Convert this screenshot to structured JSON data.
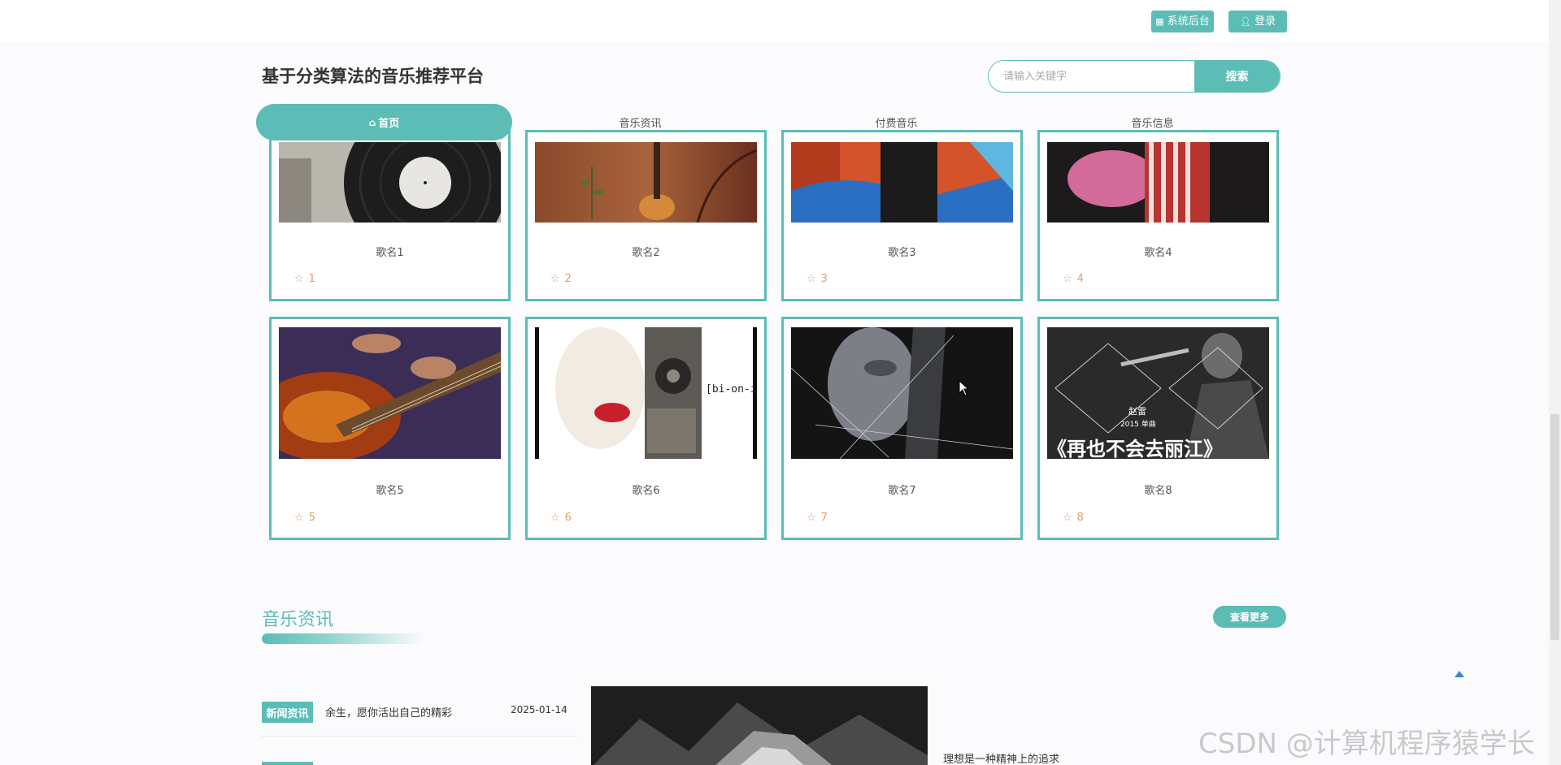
{
  "topbar": {
    "admin_label": "系统后台",
    "login_label": "登录"
  },
  "site_title": "基于分类算法的音乐推荐平台",
  "search": {
    "placeholder": "请输入关键字",
    "button_label": "搜索"
  },
  "nav": {
    "items": [
      "首页",
      "音乐资讯",
      "付费音乐",
      "音乐信息"
    ],
    "active_index": 0
  },
  "songs": [
    {
      "name": "歌名1",
      "rating": "1"
    },
    {
      "name": "歌名2",
      "rating": "2"
    },
    {
      "name": "歌名3",
      "rating": "3"
    },
    {
      "name": "歌名4",
      "rating": "4"
    },
    {
      "name": "歌名5",
      "rating": "5"
    },
    {
      "name": "歌名6",
      "rating": "6"
    },
    {
      "name": "歌名7",
      "rating": "7"
    },
    {
      "name": "歌名8",
      "rating": "8"
    }
  ],
  "image_texts": {
    "song6_label": "[bi-on-ic]",
    "song8_line1": "赵雷",
    "song8_line2": "2015 单曲",
    "song8_title": "《再也不会去丽江》"
  },
  "news_section": {
    "title": "音乐资讯",
    "more_label": "查看更多",
    "items": [
      {
        "tag": "新闻资讯",
        "title": "余生，愿你活出自己的精彩",
        "date": "2025-01-14"
      }
    ],
    "quote": "理想是一种精神上的追求"
  },
  "watermark": "CSDN @计算机程序猿学长",
  "colors": {
    "accent": "#5bbdb5",
    "rating": "#e59a6d",
    "back_to_top": "#3a86d4"
  },
  "icons": {
    "admin": "grid-icon",
    "login": "user-icon",
    "home": "home-icon",
    "rating": "star-outline-icon",
    "back_to_top": "arrow-up-icon"
  }
}
